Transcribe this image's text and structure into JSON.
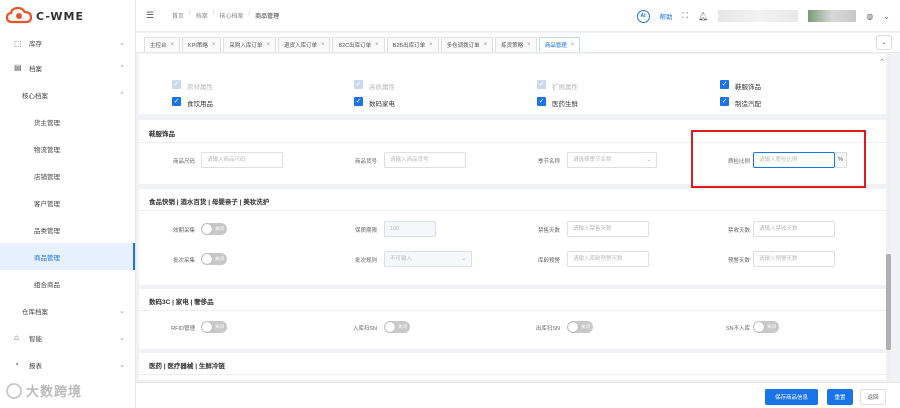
{
  "logo": {
    "text": "C-WME"
  },
  "sidebar": {
    "items": [
      {
        "label": "库存",
        "icon": "inventory-icon"
      },
      {
        "label": "档案",
        "icon": "archive-icon"
      },
      {
        "label": "核心档案"
      },
      {
        "label": "货主管理"
      },
      {
        "label": "物流管理"
      },
      {
        "label": "店铺管理"
      },
      {
        "label": "客户管理"
      },
      {
        "label": "品类管理"
      },
      {
        "label": "商品管理"
      },
      {
        "label": "组合商品"
      },
      {
        "label": "仓库档案"
      },
      {
        "label": "智能",
        "icon": "smart-icon"
      },
      {
        "label": "报表",
        "icon": "report-icon"
      }
    ],
    "watermark": "大数跨境"
  },
  "header": {
    "breadcrumb": [
      "首页",
      "档案",
      "核心档案",
      "商品管理"
    ],
    "ai_label": "AI",
    "help_label": "帮助"
  },
  "tabs": [
    {
      "label": "主控台"
    },
    {
      "label": "KPI策略"
    },
    {
      "label": "采购入库订单"
    },
    {
      "label": "退货入库订单"
    },
    {
      "label": "B2C出库订单"
    },
    {
      "label": "B2B出库订单"
    },
    {
      "label": "多仓调拨订单"
    },
    {
      "label": "拣货策略"
    },
    {
      "label": "商品管理"
    }
  ],
  "checkboxes": [
    {
      "label": "原材属性",
      "checked": true,
      "disabled": true
    },
    {
      "label": "高收属性",
      "checked": true,
      "disabled": true
    },
    {
      "label": "扩展属性",
      "checked": true,
      "disabled": true
    },
    {
      "label": "鞋服饰品",
      "checked": true,
      "disabled": false
    },
    {
      "label": "食饮用品",
      "checked": true,
      "disabled": false
    },
    {
      "label": "数码家电",
      "checked": true,
      "disabled": false
    },
    {
      "label": "医药生鲜",
      "checked": true,
      "disabled": false
    },
    {
      "label": "制造汽配",
      "checked": true,
      "disabled": false
    }
  ],
  "section_apparel": {
    "title": "鞋服饰品",
    "fields": [
      {
        "label": "商品尺码",
        "placeholder": "请输入商品尺码"
      },
      {
        "label": "商品货号",
        "placeholder": "请输入商品货号"
      },
      {
        "label": "季节名称",
        "placeholder": "请选择季节名称"
      },
      {
        "label": "质检比例",
        "placeholder": "请输入质检比例",
        "suffix": "%"
      }
    ]
  },
  "section_food": {
    "title": "食品快销 | 酒水百货 | 母婴亲子 | 美妆洗护",
    "fields": [
      {
        "label": "效期采集",
        "switch_text": "关闭"
      },
      {
        "label": "保质期限",
        "placeholder": "100"
      },
      {
        "label": "禁售天数",
        "placeholder": "请输入禁售天数"
      },
      {
        "label": "禁收天数",
        "placeholder": "请输入禁收天数"
      },
      {
        "label": "批次采集",
        "switch_text": "关闭"
      },
      {
        "label": "批次规则",
        "placeholder": "不可输入"
      },
      {
        "label": "库龄预警",
        "placeholder": "请输入库龄预警天数"
      },
      {
        "label": "预警天数",
        "placeholder": "请输入预警天数"
      }
    ]
  },
  "section_digital": {
    "title": "数码3C | 家电 | 奢侈品",
    "fields": [
      {
        "label": "RFID管理",
        "switch_text": "关闭"
      },
      {
        "label": "入库扫SN",
        "switch_text": "关闭"
      },
      {
        "label": "出库扫SN",
        "switch_text": "关闭"
      },
      {
        "label": "SN不入库",
        "switch_text": "关闭"
      }
    ]
  },
  "section_medical": {
    "title": "医药 | 医疗器械 | 生鲜冷链"
  },
  "footer": {
    "save_label": "保存商品信息",
    "reset_label": "重置",
    "back_label": "返回"
  },
  "colors": {
    "primary": "#1a73e8",
    "highlight": "#e0191e"
  }
}
